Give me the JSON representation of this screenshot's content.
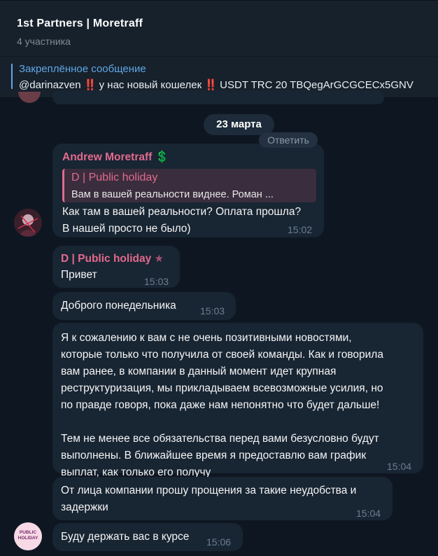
{
  "header": {
    "title": "1st Partners | Moretraff",
    "subtitle": "4 участника"
  },
  "pinned": {
    "title": "Закреплённое сообщение",
    "text_pre": "@darinazven ",
    "text_mid": " у нас новый кошелек ",
    "text_post": " USDT TRC 20 TBQegArGCGCECx5GNV",
    "bang": "‼️"
  },
  "chat": {
    "date_label": "23 марта",
    "reply_label": "Ответить",
    "messages": [
      {
        "sender": "Andrew Moretraff",
        "sender_emoji": "💲",
        "quote": {
          "name": "D | Public holiday",
          "text": "Вам в вашей реальности виднее.   Роман ..."
        },
        "text": "Как там в вашей реальности? Оплата прошла?\nВ нашей просто не было)",
        "time": "15:02"
      },
      {
        "sender": "D | Public holiday",
        "sender_emoji": "★",
        "text": "Привет",
        "time": "15:03"
      },
      {
        "text": "Доброго понедельника",
        "time": "15:03"
      },
      {
        "text": "Я к сожалению к вам с не очень позитивными новостями,\nкоторые только что получила от своей команды. Как и говорила\nвам ранее, в компании в данный момент идет крупная\nреструктуризация, мы прикладываем всевозможные усилия, но\nпо правде говоря, пока даже нам непонятно что будет дальше!\n\n Тем не менее все обязательства перед вами безусловно будут\nвыполнены. В ближайшее время я предоставлю вам график\nвыплат, как только его получу",
        "time": "15:04"
      },
      {
        "text": "От лица компании прошу прощения за такие неудобства и\nзадержки",
        "time": "15:04"
      },
      {
        "text": "Буду держать вас в курсе",
        "time": "15:06"
      }
    ],
    "public_avatar_label": "PUBLIC HOLIDAY"
  },
  "colors": {
    "background": "#0e1621",
    "bubble": "#182533",
    "name_pink": "#e26a8d",
    "link_blue": "#5ea7e6",
    "time_gray": "#6d7f8f"
  }
}
